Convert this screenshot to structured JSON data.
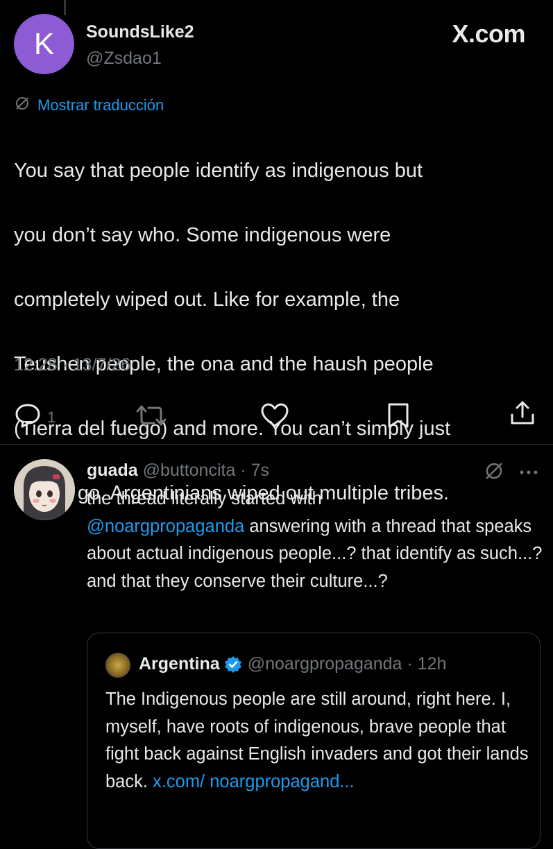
{
  "main_tweet": {
    "avatar_letter": "K",
    "avatar_color": "#8d5bd3",
    "display_name": "SoundsLike2",
    "handle": "@Zsdao1",
    "translate_label": "Mostrar traducción",
    "text_lines": [
      "You say that people identify as indigenous but",
      "you don’t say who. Some indigenous were",
      "completely wiped out. Like for example, the",
      "Teushen people, the ona and the haush people",
      "(Tierra del fuego) and more. You can’t simply just",
      "let this go. Argentinians wiped out multiple tribes."
    ],
    "timestamp": "12:28 · 13/7/26",
    "reply_count": "1"
  },
  "brand": {
    "logo_text": "X.com"
  },
  "reply": {
    "display_name": "guada",
    "handle_time": "@buttoncita · 7s",
    "text_before_mention": "the thread literally started with",
    "mention": "@noargpropaganda",
    "text_after_mention": " answering with a thread",
    "text_rest": "that speaks about actual indigenous people...? that identify as such...? and that they conserve their culture...?"
  },
  "quote": {
    "display_name": "Argentina",
    "handle_time": "@noargpropaganda · 12h",
    "text": "The Indigenous people are still around, right here. I, myself, have roots of indigenous, brave people that fight back against English invaders and got their lands back. ",
    "link": "x.com/ noargpropagand..."
  },
  "colors": {
    "accent": "#1d9bf0",
    "muted": "#71767b",
    "verified": "#1d9bf0"
  },
  "icons": [
    "translate-icon",
    "reply-icon",
    "retweet-icon",
    "like-icon",
    "bookmark-icon",
    "share-icon",
    "more-icon",
    "verified-badge-icon"
  ]
}
